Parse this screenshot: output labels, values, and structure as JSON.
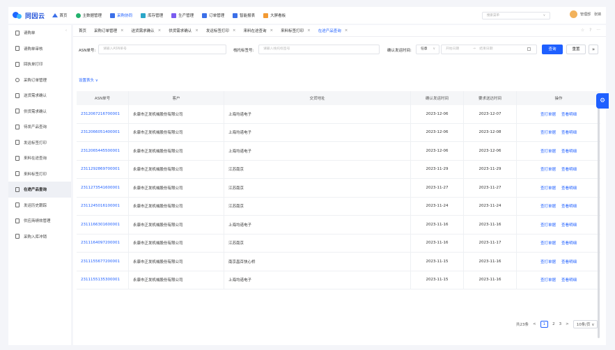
{
  "app": {
    "logo_text": "同因云"
  },
  "topnav": {
    "items": [
      {
        "label": "首页",
        "icon": "home-icon"
      },
      {
        "label": "主数据管理",
        "icon": "database-icon"
      },
      {
        "label": "采购协同",
        "icon": "cart-icon",
        "active": true
      },
      {
        "label": "库存管理",
        "icon": "warehouse-icon"
      },
      {
        "label": "生产管理",
        "icon": "factory-icon"
      },
      {
        "label": "订单管理",
        "icon": "order-icon"
      },
      {
        "label": "智能报表",
        "icon": "report-icon"
      },
      {
        "label": "大屏看板",
        "icon": "dashboard-icon"
      }
    ],
    "search_placeholder": "搜索菜单",
    "user": {
      "role": "管理部",
      "name": "张婧"
    }
  },
  "sidebar": {
    "items": [
      {
        "label": "请购单",
        "icon": "document-icon"
      },
      {
        "label": "请购单审核",
        "icon": "document-icon"
      },
      {
        "label": "回执单打印",
        "icon": "document-icon"
      },
      {
        "label": "采购订单管理",
        "icon": "gear-icon"
      },
      {
        "label": "送货需求确认",
        "icon": "document-icon"
      },
      {
        "label": "供货需求确认",
        "icon": "document-icon"
      },
      {
        "label": "待发产品查询",
        "icon": "document-icon"
      },
      {
        "label": "发运标签打印",
        "icon": "document-icon"
      },
      {
        "label": "来料在途查询",
        "icon": "document-icon"
      },
      {
        "label": "来料标签打印",
        "icon": "document-icon"
      },
      {
        "label": "在途产品查询",
        "icon": "document-icon",
        "active": true
      },
      {
        "label": "发运历史跟踪",
        "icon": "document-icon"
      },
      {
        "label": "供应商绩效管理",
        "icon": "document-icon"
      },
      {
        "label": "采购入库冲销",
        "icon": "document-icon"
      }
    ]
  },
  "tabs": [
    {
      "label": "首页",
      "closable": false
    },
    {
      "label": "采购订单管理",
      "closable": true
    },
    {
      "label": "送货需求确认",
      "closable": true
    },
    {
      "label": "供货需求确认",
      "closable": true
    },
    {
      "label": "发运标签打印",
      "closable": true
    },
    {
      "label": "来料在途查询",
      "closable": true
    },
    {
      "label": "来料标签打印",
      "closable": true
    },
    {
      "label": "在途产品查询",
      "closable": true,
      "active": true
    }
  ],
  "filters": {
    "asn_label": "ASN单号:",
    "asn_placeholder": "请输入ASN单号",
    "pallet_label": "栈托标签号:",
    "pallet_placeholder": "请输入栈托标签号",
    "date_label": "确认发运时间:",
    "date_mode": "任意",
    "start_placeholder": "开始日期",
    "range_sep": "→",
    "end_placeholder": "结束日期",
    "query_button": "查询",
    "reset_button": "重置",
    "expand_icon": "double-chevron-down-icon"
  },
  "set_columns": "设置表头 ∨",
  "table": {
    "headers": [
      "ASN单号",
      "客户",
      "交货地址",
      "确认发运时间",
      "要求送达时间",
      "操作"
    ],
    "op_labels": [
      "查打单据",
      "查看明细"
    ],
    "rows": [
      {
        "asn": "2312067216700001",
        "customer": "永康市正发机械股份有限公司",
        "address": "上海均诺电子",
        "confirm": "2023-12-06",
        "required": "2023-12-07"
      },
      {
        "asn": "2312066051400001",
        "customer": "永康市正发机械股份有限公司",
        "address": "上海均诺电子",
        "confirm": "2023-12-06",
        "required": "2023-12-08"
      },
      {
        "asn": "2312065445500001",
        "customer": "永康市正发机械股份有限公司",
        "address": "上海均诺电子",
        "confirm": "2023-12-06",
        "required": "2023-12-06"
      },
      {
        "asn": "2311292869700001",
        "customer": "永康市正发机械股份有限公司",
        "address": "江苏南京",
        "confirm": "2023-11-29",
        "required": "2023-11-29"
      },
      {
        "asn": "2311273541600001",
        "customer": "永康市正发机械股份有限公司",
        "address": "江苏南京",
        "confirm": "2023-11-27",
        "required": "2023-11-27"
      },
      {
        "asn": "2311245016100001",
        "customer": "永康市正发机械股份有限公司",
        "address": "江苏南京",
        "confirm": "2023-11-24",
        "required": "2023-11-24"
      },
      {
        "asn": "2311166301600001",
        "customer": "永康市正发机械股份有限公司",
        "address": "上海均诺电子",
        "confirm": "2023-11-16",
        "required": "2023-11-16"
      },
      {
        "asn": "2311164097200001",
        "customer": "永康市正发机械股份有限公司",
        "address": "江苏南京",
        "confirm": "2023-11-16",
        "required": "2023-11-17"
      },
      {
        "asn": "2311155677200001",
        "customer": "永康市正发机械股份有限公司",
        "address": "南京昌百快心桥",
        "confirm": "2023-11-15",
        "required": "2023-11-16"
      },
      {
        "asn": "2311155135300001",
        "customer": "永康市正发机械股份有限公司",
        "address": "上海均诺电子",
        "confirm": "2023-11-15",
        "required": "2023-11-16"
      }
    ]
  },
  "pagination": {
    "total": "共23条",
    "pages": [
      "1",
      "2",
      "3"
    ],
    "current": "1",
    "next": ">",
    "page_size": "10条/页 ∨"
  },
  "colors": {
    "primary": "#1e5fff",
    "bg": "#f4f5f9"
  }
}
